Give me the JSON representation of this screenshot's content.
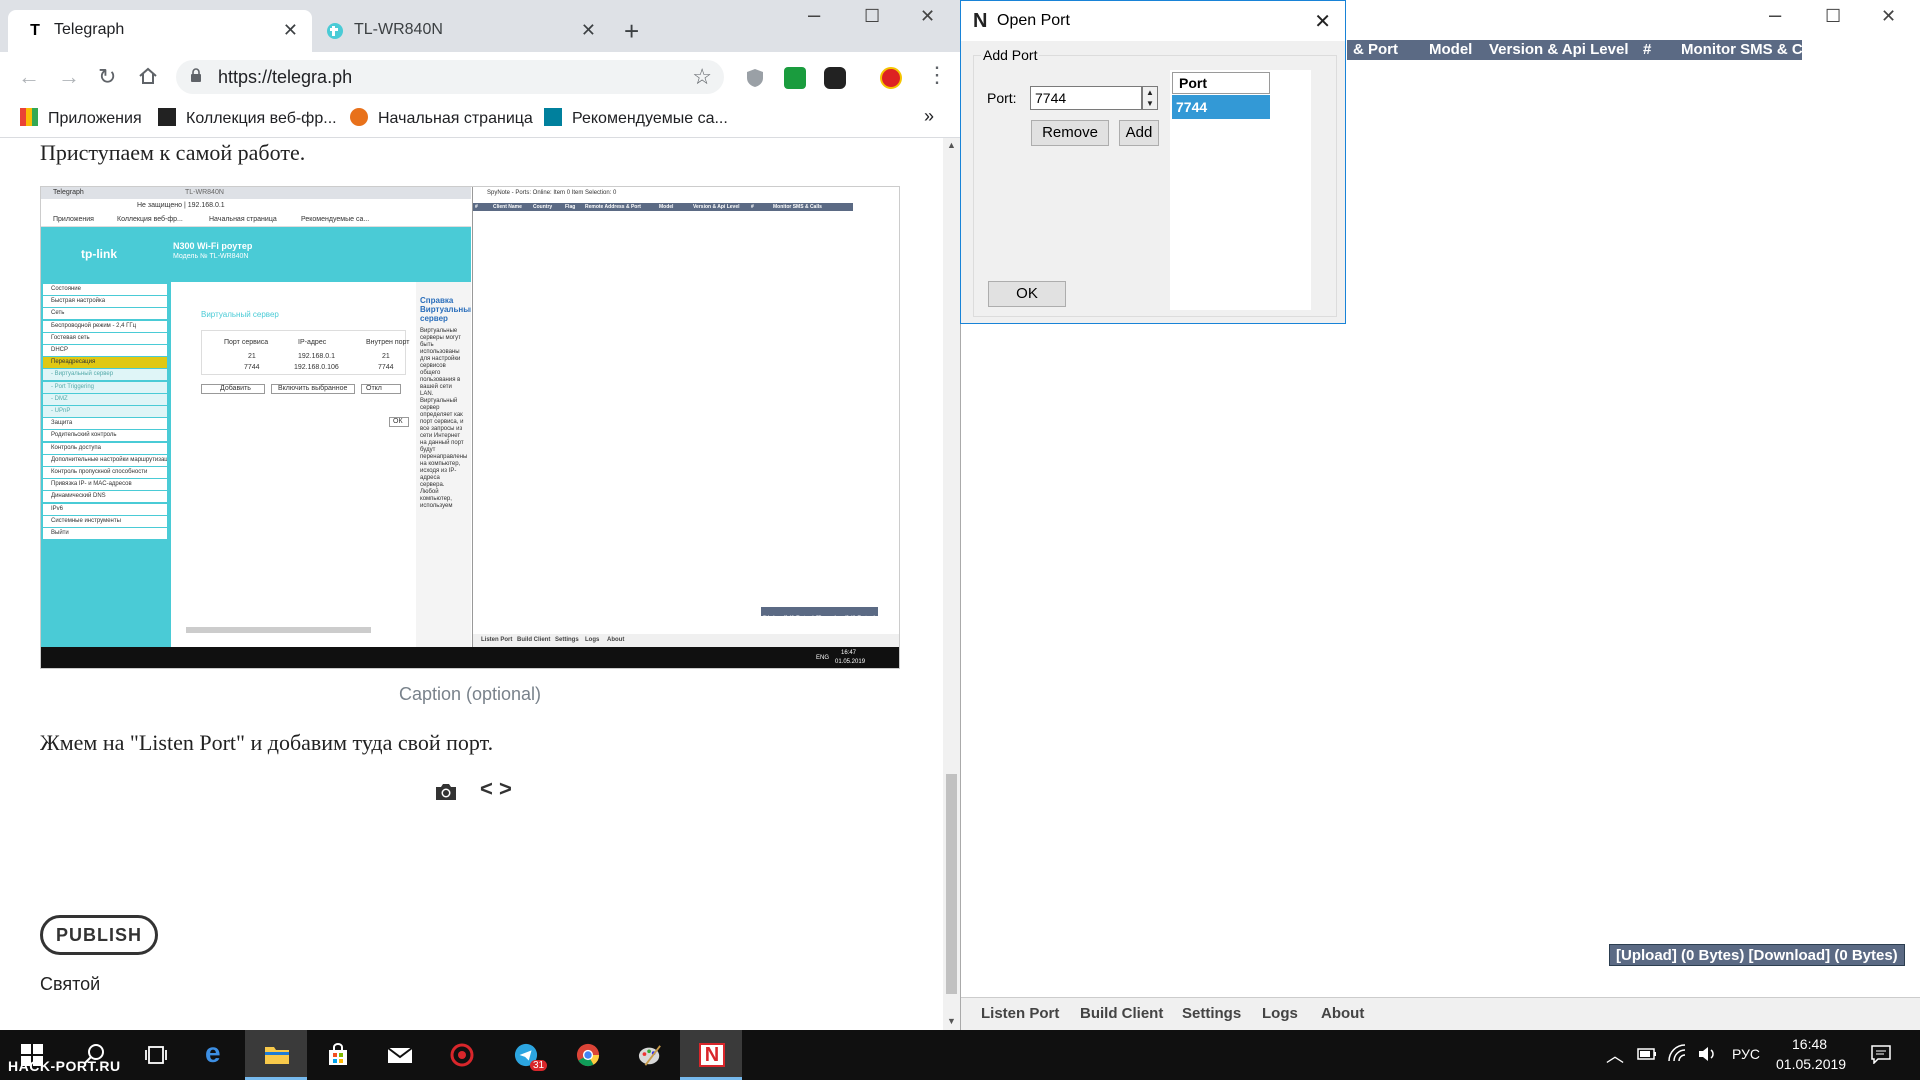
{
  "browser": {
    "tabs": [
      {
        "title": "Telegraph",
        "favicon": "T"
      },
      {
        "title": "TL-WR840N",
        "favicon": "tp-link"
      }
    ],
    "url": "https://telegra.ph",
    "bookmarks": [
      {
        "label": "Приложения"
      },
      {
        "label": "Коллекция веб-фр..."
      },
      {
        "label": "Начальная страница"
      },
      {
        "label": "Рекомендуемые са..."
      }
    ],
    "bookmarks_more": "»"
  },
  "article": {
    "paragraph1": "Приступаем к самой работе.",
    "caption": "Caption (optional)",
    "paragraph2": "Жмем на \"Listen Port\" и добавим туда свой порт.",
    "code_icon": "< >",
    "publish_label": "PUBLISH",
    "author": "Святой"
  },
  "embedded_screenshot": {
    "tab1": "Telegraph",
    "tab2": "TL-WR840N",
    "url": "Не защищено  |  192.168.0.1",
    "bm1": "Приложения",
    "bm2": "Коллекция веб-фр...",
    "bm3": "Начальная страница",
    "bm4": "Рекомендуемые са...",
    "router_title": "N300 Wi-Fi роутер",
    "router_model": "Модель № TL-WR840N",
    "logo": "tp-link",
    "menu": [
      "Состояние",
      "Быстрая настройка",
      "Сеть",
      "Беспроводной режим - 2,4 ГГц",
      "Гостевая сеть",
      "DHCP",
      "Переадресация",
      "- Виртуальный сервер",
      "- Port Triggering",
      "- DMZ",
      "- UPnP",
      "Защита",
      "Родительский контроль",
      "Контроль доступа",
      "Дополнительные настройки маршрутизации",
      "Контроль пропускной способности",
      "Привязка IP- и MAC-адресов",
      "Динамический DNS",
      "IPv6",
      "Системные инструменты",
      "Выйти"
    ],
    "section": "Виртуальный сервер",
    "table_head": [
      "Порт сервиса",
      "IP-адрес",
      "Внутрен порт"
    ],
    "rows": [
      [
        "21",
        "192.168.0.1",
        "21"
      ],
      [
        "7744",
        "192.168.0.106",
        "7744"
      ]
    ],
    "btn_add": "Добавить",
    "btn_enable": "Включить выбранное",
    "btn_off": "Откл",
    "btn_ok": "ОК",
    "help_title": "Справка Виртуальный сервер",
    "help_text": "Виртуальные серверы могут быть использованы для настройки сервисов общего пользования в вашей сети LAN. Виртуальный сервер определяет как порт сервиса, и все запросы из сети Интернет на данный порт будут перенаправлены на компьютер, исходя из IP-адреса сервера. Любой компьютер, используем",
    "spy_title": "SpyNote - Ports: Online: Item 0 Item Selection: 0",
    "spy_cols": [
      "#",
      "Client Name",
      "Country",
      "Flag",
      "Remote Address & Port",
      "Model",
      "Version & Api Level",
      "#",
      "Monitor SMS & Calls"
    ],
    "spy_status": "[Upload] (0 Bytes) [Download] (0 Bytes)",
    "spy_bottom": [
      "Listen Port",
      "Build Client",
      "Settings",
      "Logs",
      "About"
    ],
    "tray_lang": "ENG",
    "tray_time": "16:47",
    "tray_date": "01.05.2019"
  },
  "app": {
    "columns": [
      "& Port",
      "Model",
      "Version & Api Level",
      "#",
      "Monitor SMS & Calls"
    ],
    "status": "[Upload] (0 Bytes) [Download] (0 Bytes)",
    "bottom_tabs": [
      "Listen Port",
      "Build Client",
      "Settings",
      "Logs",
      "About"
    ],
    "accent": "#5b6a84"
  },
  "dialog": {
    "title": "Open Port",
    "group_label": "Add Port",
    "port_label": "Port:",
    "port_value": "7744",
    "remove_label": "Remove",
    "add_label": "Add",
    "ok_label": "OK",
    "list_header": "Port",
    "list_items": [
      "7744"
    ]
  },
  "taskbar": {
    "telegram_badge": "31",
    "lang": "РУС",
    "time": "16:48",
    "date": "01.05.2019",
    "watermark": "HACK-PORT.RU"
  }
}
